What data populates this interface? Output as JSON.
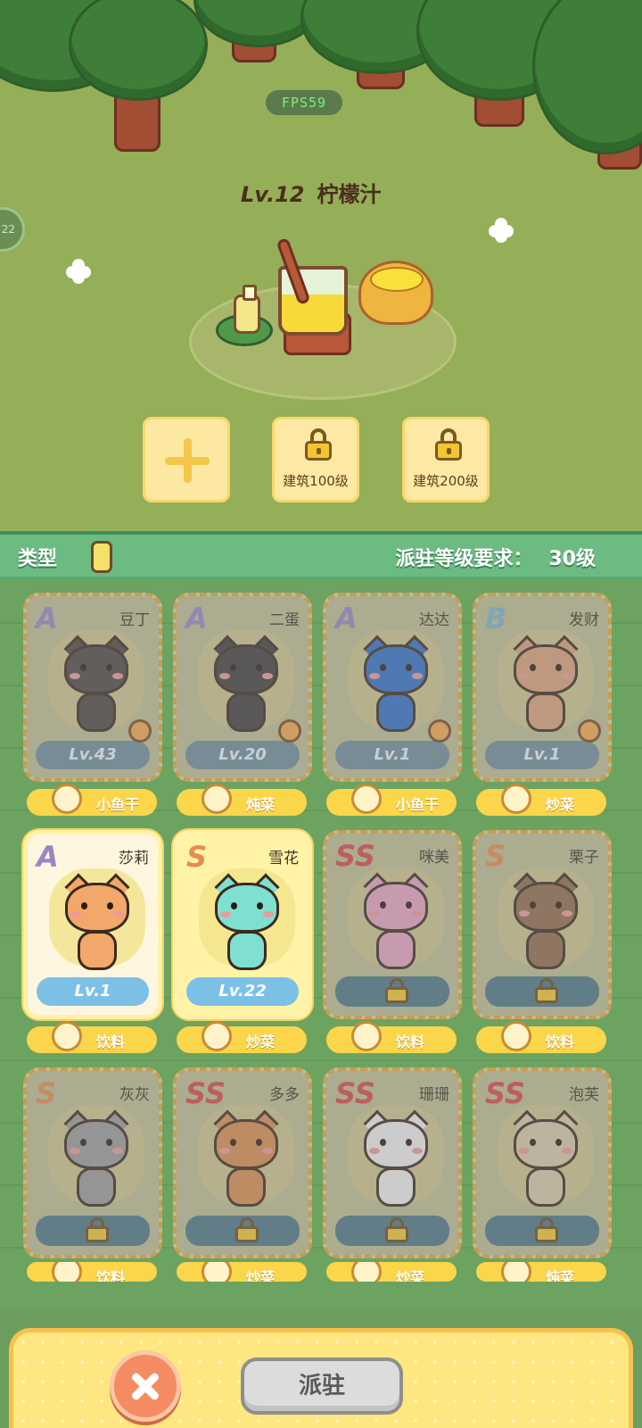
{
  "hud": {
    "fps": "FPS59",
    "side_badge": "22"
  },
  "building": {
    "level": "Lv.12",
    "name": "柠檬汁"
  },
  "slots": [
    {
      "type": "add"
    },
    {
      "type": "locked",
      "label": "建筑100级"
    },
    {
      "type": "locked",
      "label": "建筑200级"
    }
  ],
  "filter_bar": {
    "type_label": "类型",
    "requirement_label": "派驻等级要求：",
    "requirement_value": "30级"
  },
  "cats": [
    {
      "grade": "A",
      "name": "豆丁",
      "level": "Lv.43",
      "locked": false,
      "style": "dim",
      "tag": "小鱼干",
      "color": "#4a4542"
    },
    {
      "grade": "A",
      "name": "二蛋",
      "level": "Lv.20",
      "locked": false,
      "style": "dim",
      "tag": "炖菜",
      "color": "#3f3c3c"
    },
    {
      "grade": "A",
      "name": "达达",
      "level": "Lv.1",
      "locked": false,
      "style": "dim",
      "tag": "小鱼干",
      "color": "#2f6fc6"
    },
    {
      "grade": "B",
      "name": "发财",
      "level": "Lv.1",
      "locked": false,
      "style": "dim",
      "tag": "炒菜",
      "color": "#d9a07a"
    },
    {
      "grade": "A",
      "name": "莎莉",
      "level": "Lv.1",
      "locked": false,
      "style": "bright",
      "tag": "饮料",
      "color": "#f3a86b"
    },
    {
      "grade": "S",
      "name": "雪花",
      "level": "Lv.22",
      "locked": false,
      "style": "gold",
      "tag": "炒菜",
      "color": "#7fe0d2"
    },
    {
      "grade": "SS",
      "name": "咪美",
      "level": "",
      "locked": true,
      "style": "dim",
      "tag": "饮料",
      "color": "#e7a3c2"
    },
    {
      "grade": "S",
      "name": "栗子",
      "level": "",
      "locked": true,
      "style": "dim",
      "tag": "饮料",
      "color": "#8f6a4e"
    },
    {
      "grade": "S",
      "name": "灰灰",
      "level": "",
      "locked": true,
      "style": "dim",
      "tag": "饮料",
      "color": "#9a9a9a"
    },
    {
      "grade": "SS",
      "name": "多多",
      "level": "",
      "locked": true,
      "style": "dim",
      "tag": "炒菜",
      "color": "#d98d4c"
    },
    {
      "grade": "SS",
      "name": "珊珊",
      "level": "",
      "locked": true,
      "style": "dim",
      "tag": "炒菜",
      "color": "#eeeeee"
    },
    {
      "grade": "SS",
      "name": "泡芙",
      "level": "",
      "locked": true,
      "style": "dim",
      "tag": "炖菜",
      "color": "#d8c8a8"
    }
  ],
  "actions": {
    "confirm_label": "派驻"
  },
  "colors": {
    "accent_green": "#6bbb82",
    "tag_yellow": "#fbd54a",
    "close_orange": "#f58b62"
  }
}
